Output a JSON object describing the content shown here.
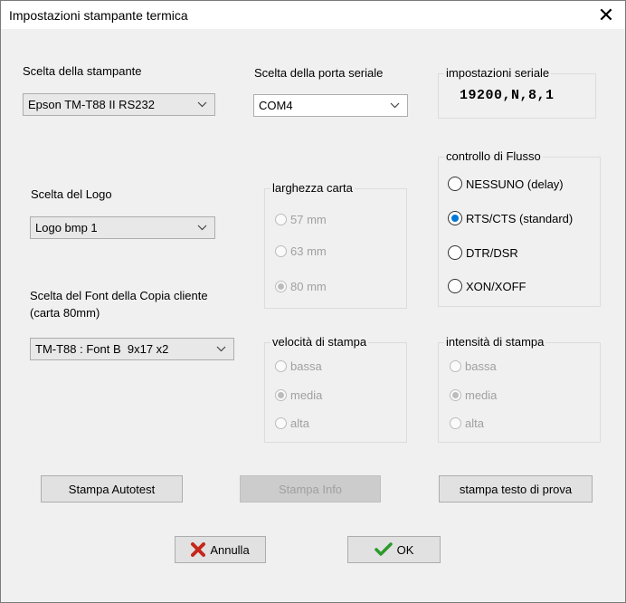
{
  "window": {
    "title": "Impostazioni stampante termica",
    "close_glyph": "✕"
  },
  "printer": {
    "label": "Scelta della stampante",
    "value": "Epson TM-T88 II RS232"
  },
  "serial_port": {
    "label": "Scelta della porta seriale",
    "value": "COM4"
  },
  "serial_settings": {
    "label": "impostazioni seriale",
    "value": "19200,N,8,1"
  },
  "logo": {
    "label": "Scelta del Logo",
    "value": "Logo bmp 1"
  },
  "font": {
    "label_line1": "Scelta del Font della Copia cliente",
    "label_line2": "(carta 80mm)",
    "value": "TM-T88 : Font B  9x17 x2"
  },
  "paper_width": {
    "label": "larghezza carta",
    "options": [
      "57 mm",
      "63 mm",
      "80 mm"
    ],
    "selected": "80 mm",
    "enabled": false
  },
  "flow_control": {
    "label": "controllo di Flusso",
    "options": [
      "NESSUNO (delay)",
      "RTS/CTS (standard)",
      "DTR/DSR",
      "XON/XOFF"
    ],
    "selected": "RTS/CTS (standard)"
  },
  "print_speed": {
    "label": "velocità di stampa",
    "options": [
      "bassa",
      "media",
      "alta"
    ],
    "selected": "media",
    "enabled": false
  },
  "print_intensity": {
    "label": "intensità di stampa",
    "options": [
      "bassa",
      "media",
      "alta"
    ],
    "selected": "media",
    "enabled": false
  },
  "buttons": {
    "autotest": "Stampa Autotest",
    "info": "Stampa Info",
    "test_text": "stampa testo di prova",
    "cancel": "Annulla",
    "ok": "OK"
  },
  "icons": {
    "cancel": "x-icon",
    "ok": "checkmark-icon",
    "dropdown": "chevron-down-icon"
  },
  "colors": {
    "radio_selected": "#0078d7",
    "cancel_icon": "#c4281c",
    "ok_icon": "#2c9a2c"
  }
}
